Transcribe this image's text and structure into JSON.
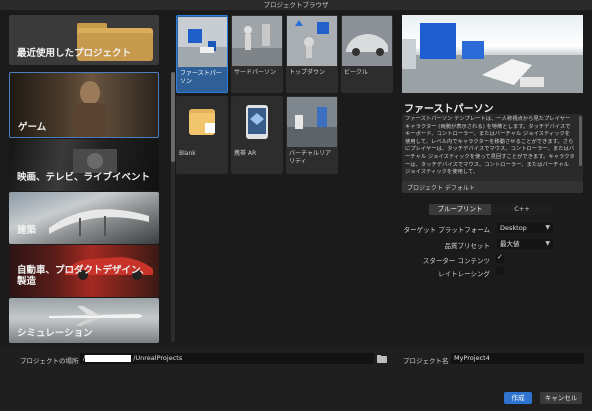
{
  "window": {
    "title": "プロジェクトブラウザ"
  },
  "categories": [
    {
      "label": "最近使用したプロジェクト"
    },
    {
      "label": "ゲーム"
    },
    {
      "label": "映画、テレビ、ライブイベント"
    },
    {
      "label": "建築"
    },
    {
      "label": "自動車、プロダクトデザイン、製造"
    },
    {
      "label": "シミュレーション"
    }
  ],
  "templates": [
    {
      "label": "ファーストパーソン",
      "selected": true
    },
    {
      "label": "サードパーソン"
    },
    {
      "label": "トップダウン"
    },
    {
      "label": "ビークル"
    },
    {
      "label": "Blank"
    },
    {
      "label": "携帯 AR"
    },
    {
      "label": "バーチャルリアリティ"
    }
  ],
  "details": {
    "title": "ファーストパーソン",
    "description": "ファーストパーソン テンプレートは、一人称視点から見たプレイヤー キャラクター (両腕が表示される) を特徴とします。タッチデバイスでキーボード、コントローラー、またはバーチャル ジョイスティックを使用して、レベル内でキャラクターを移動させることができます。さらにプレイヤーは、タッチデバイスでマウス、コントローラー、またはバーチャル ジョイスティックを使って見回すことができます。キャラクターは、タッチデバイスでマウス、コントローラー、またはバーチャル ジョイスティックを使用して、",
    "footer": "プロジェクト デフォルト"
  },
  "tabs": {
    "blueprint": "ブループリント",
    "cpp": "C++"
  },
  "options": {
    "target_platform_label": "ターゲット プラットフォーム",
    "target_platform_value": "Desktop",
    "quality_label": "品質プリセット",
    "quality_value": "最大値",
    "starter_label": "スターター コンテンツ",
    "starter_checked": true,
    "raytracing_label": "レイトレーシング",
    "raytracing_checked": false
  },
  "project": {
    "location_label": "プロジェクトの場所",
    "location_prefix": "/",
    "location_suffix": "/UnrealProjects",
    "name_label": "プロジェクト名",
    "name_value": "MyProject4"
  },
  "buttons": {
    "create": "作成",
    "cancel": "キャンセル"
  }
}
